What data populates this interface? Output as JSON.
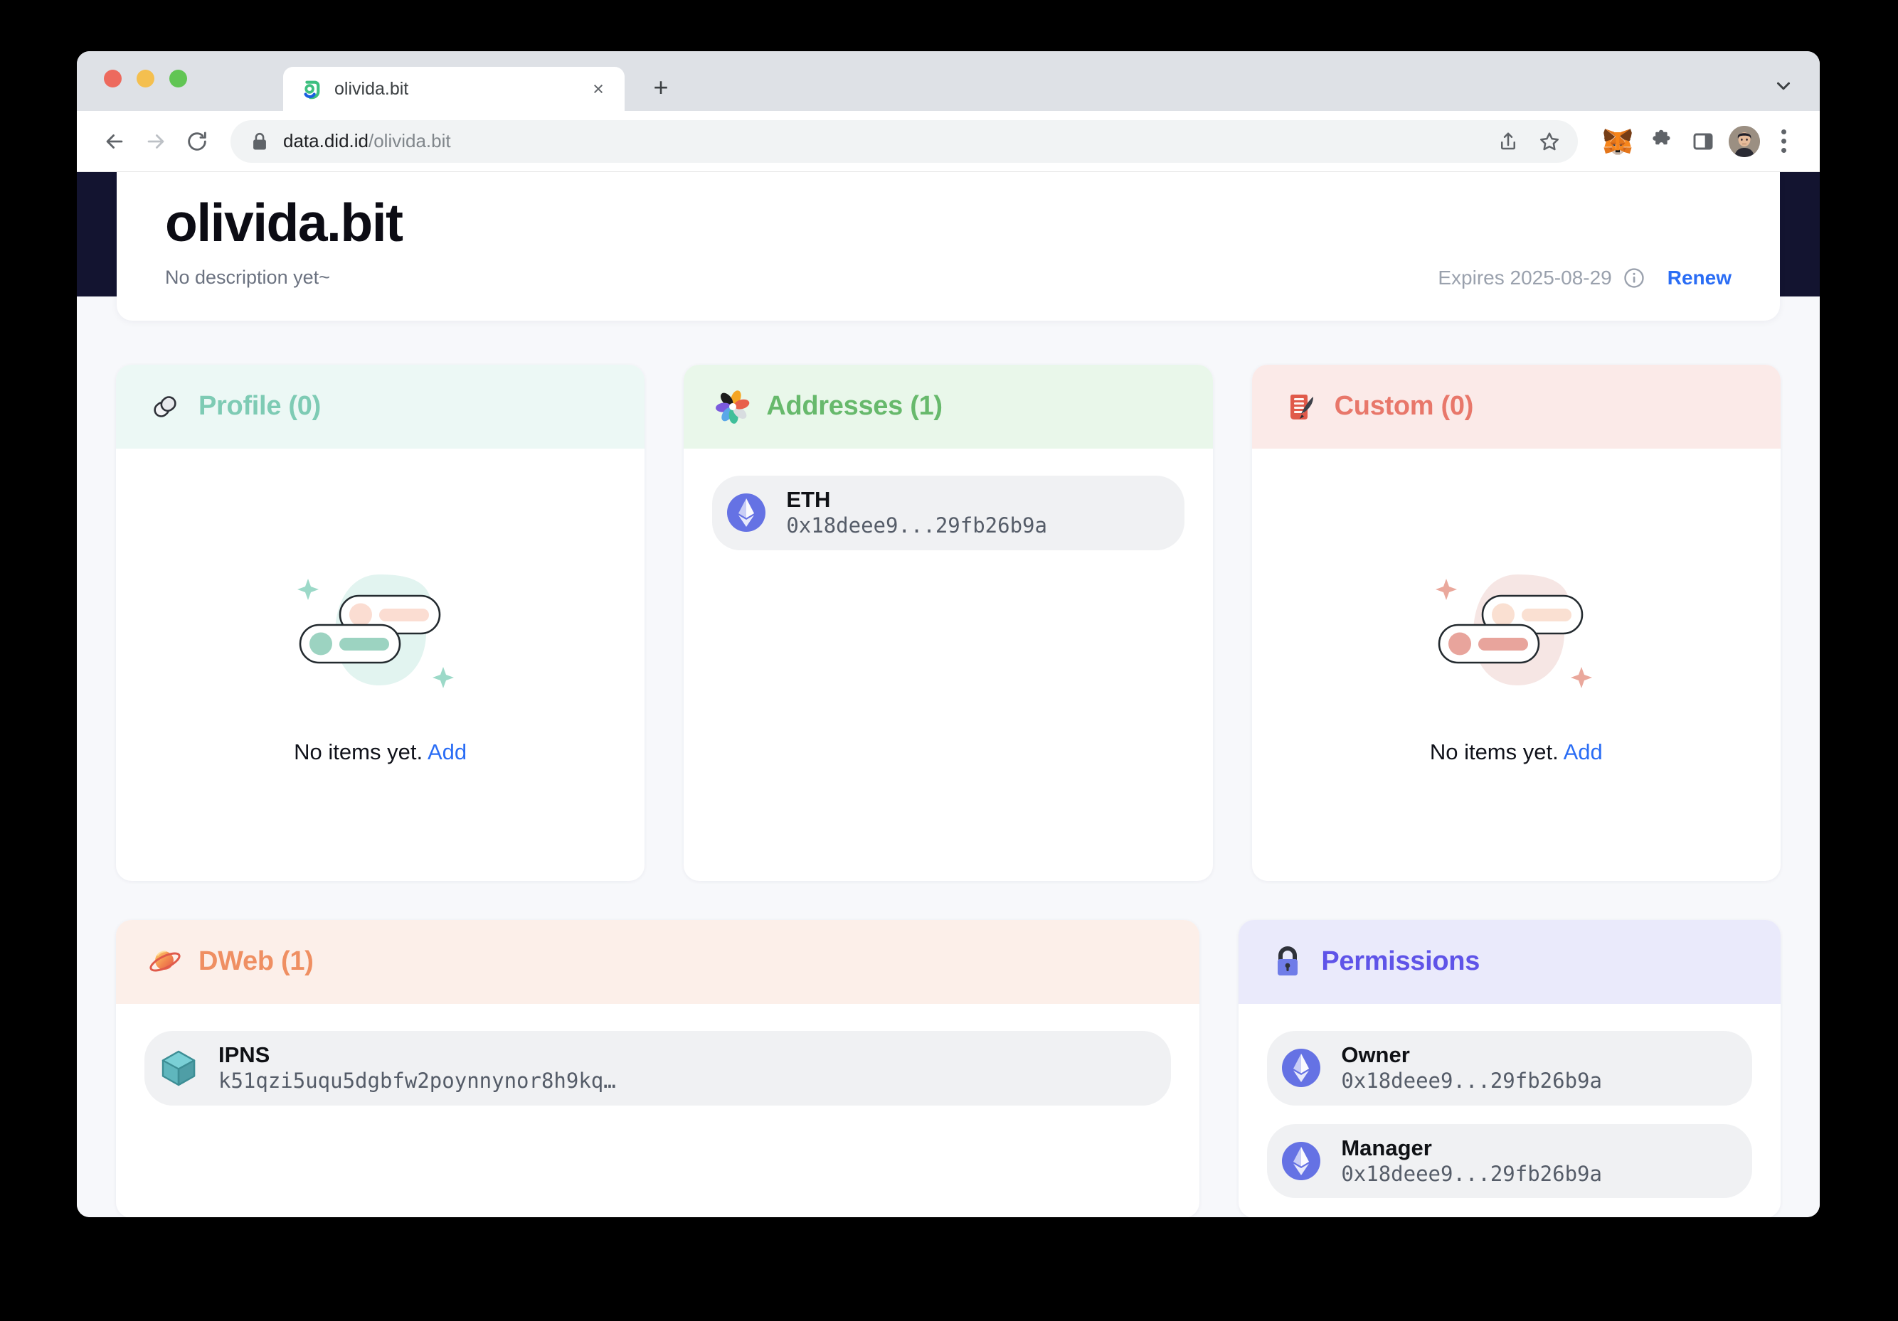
{
  "browser": {
    "tab": {
      "title": "olivida.bit",
      "favicon_name": "did-logo-icon",
      "close_label": "×"
    },
    "new_tab_label": "+",
    "toolbar": {
      "back_label": "←",
      "forward_label": "→",
      "reload_label": "↻",
      "url_secure": "data.did.id",
      "url_path": "/olivida.bit",
      "icons": [
        "share-icon",
        "bookmark-star-icon",
        "metamask-fox-icon",
        "extensions-puzzle-icon",
        "side-panel-icon",
        "profile-avatar",
        "three-dot-menu-icon"
      ]
    }
  },
  "header": {
    "domain": "olivida.bit",
    "description": "No description yet~",
    "expires": "Expires 2025-08-29",
    "renew_label": "Renew"
  },
  "cards": {
    "profile": {
      "title": "Profile (0)",
      "emoji_name": "chain-link-icon",
      "empty_text": "No items yet.",
      "add_label": "Add"
    },
    "addresses": {
      "title": "Addresses (1)",
      "emoji_name": "pinwheel-flower-icon",
      "entries": [
        {
          "label": "ETH",
          "value": "0x18deee9...29fb26b9a",
          "icon_name": "ethereum-icon"
        }
      ]
    },
    "custom": {
      "title": "Custom (0)",
      "emoji_name": "scroll-quill-icon",
      "empty_text": "No items yet.",
      "add_label": "Add"
    },
    "dweb": {
      "title": "DWeb (1)",
      "emoji_name": "ringed-planet-icon",
      "entries": [
        {
          "label": "IPNS",
          "value": "k51qzi5uqu5dgbfw2poynnynor8h9kq…",
          "icon_name": "ipfs-cube-icon"
        }
      ]
    },
    "permissions": {
      "title": "Permissions",
      "emoji_name": "lock-icon",
      "entries": [
        {
          "label": "Owner",
          "value": "0x18deee9...29fb26b9a",
          "icon_name": "ethereum-icon"
        },
        {
          "label": "Manager",
          "value": "0x18deee9...29fb26b9a",
          "icon_name": "ethereum-icon"
        }
      ]
    }
  },
  "colors": {
    "accent_link": "#2a6df5",
    "navy_band": "#131430",
    "profile_green": "#7ecbb4",
    "addresses_green": "#67b96c",
    "custom_red": "#e8776a",
    "dweb_orange": "#ef8f62",
    "permissions_purple": "#5f54e8"
  }
}
